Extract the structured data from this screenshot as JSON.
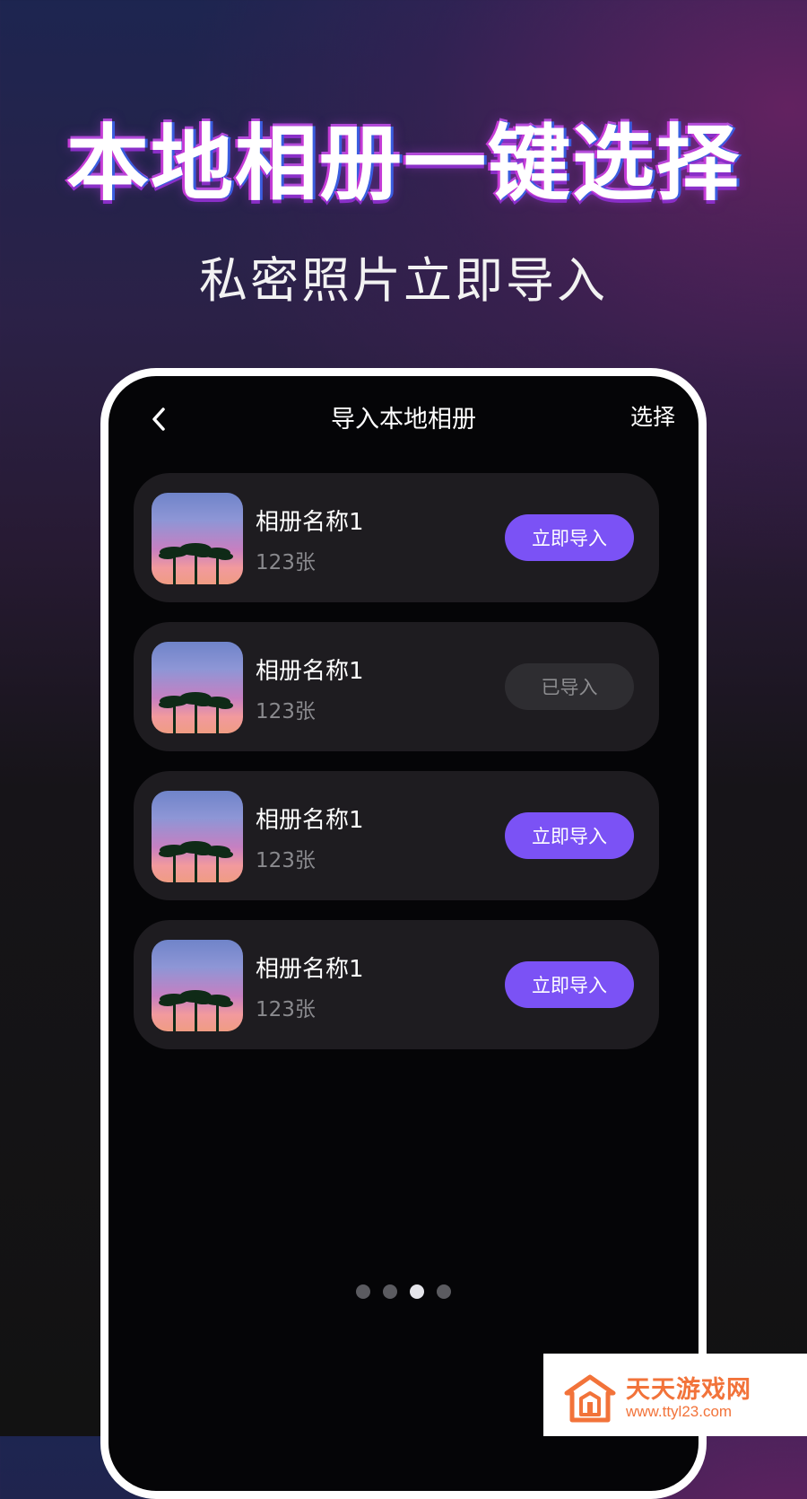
{
  "promo": {
    "headline": "本地相册一键选择",
    "subline": "私密照片立即导入"
  },
  "nav": {
    "back_icon": "chevron-left-icon",
    "title": "导入本地相册",
    "action": "选择"
  },
  "albums": [
    {
      "name": "相册名称1",
      "count": "123张",
      "button": "立即导入",
      "state": "import"
    },
    {
      "name": "相册名称1",
      "count": "123张",
      "button": "已导入",
      "state": "imported"
    },
    {
      "name": "相册名称1",
      "count": "123张",
      "button": "立即导入",
      "state": "import"
    },
    {
      "name": "相册名称1",
      "count": "123张",
      "button": "立即导入",
      "state": "import"
    }
  ],
  "pager": {
    "total": 4,
    "active_index": 3
  },
  "watermark": {
    "title": "天天游戏网",
    "url": "www.ttyl23.com",
    "logo_icon": "house-logo-icon"
  },
  "colors": {
    "accent": "#7b52f5",
    "watermark": "#f2733a"
  }
}
